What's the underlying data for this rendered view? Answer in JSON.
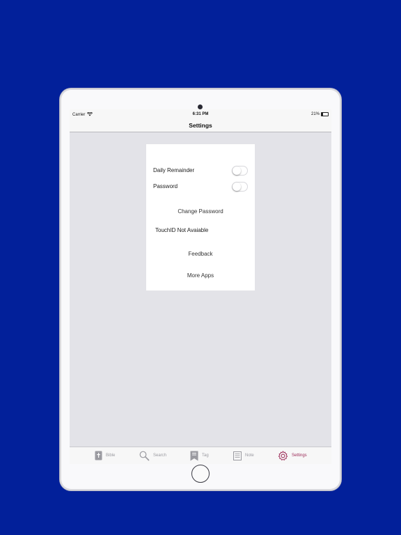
{
  "status_bar": {
    "carrier": "Carrier",
    "time": "6:31 PM",
    "battery_percent": "21%",
    "battery_level": 0.21
  },
  "nav": {
    "title": "Settings"
  },
  "settings": {
    "daily_reminder_label": "Daily Remainder",
    "daily_reminder_on": false,
    "password_label": "Password",
    "password_on": false,
    "change_password": "Change Password",
    "touchid_status": "TouchID Not Avaiable",
    "feedback": "Feedback",
    "more_apps": "More Apps"
  },
  "tabs": [
    {
      "label": "Bible",
      "icon": "bible-icon",
      "active": false
    },
    {
      "label": "Search",
      "icon": "search-icon",
      "active": false
    },
    {
      "label": "Tag",
      "icon": "tag-icon",
      "active": false
    },
    {
      "label": "Note",
      "icon": "note-icon",
      "active": false
    },
    {
      "label": "Settings",
      "icon": "gear-icon",
      "active": true
    }
  ],
  "colors": {
    "background": "#02209a",
    "active_tab": "#9b2a57",
    "inactive_tab": "#9a9aa0"
  }
}
